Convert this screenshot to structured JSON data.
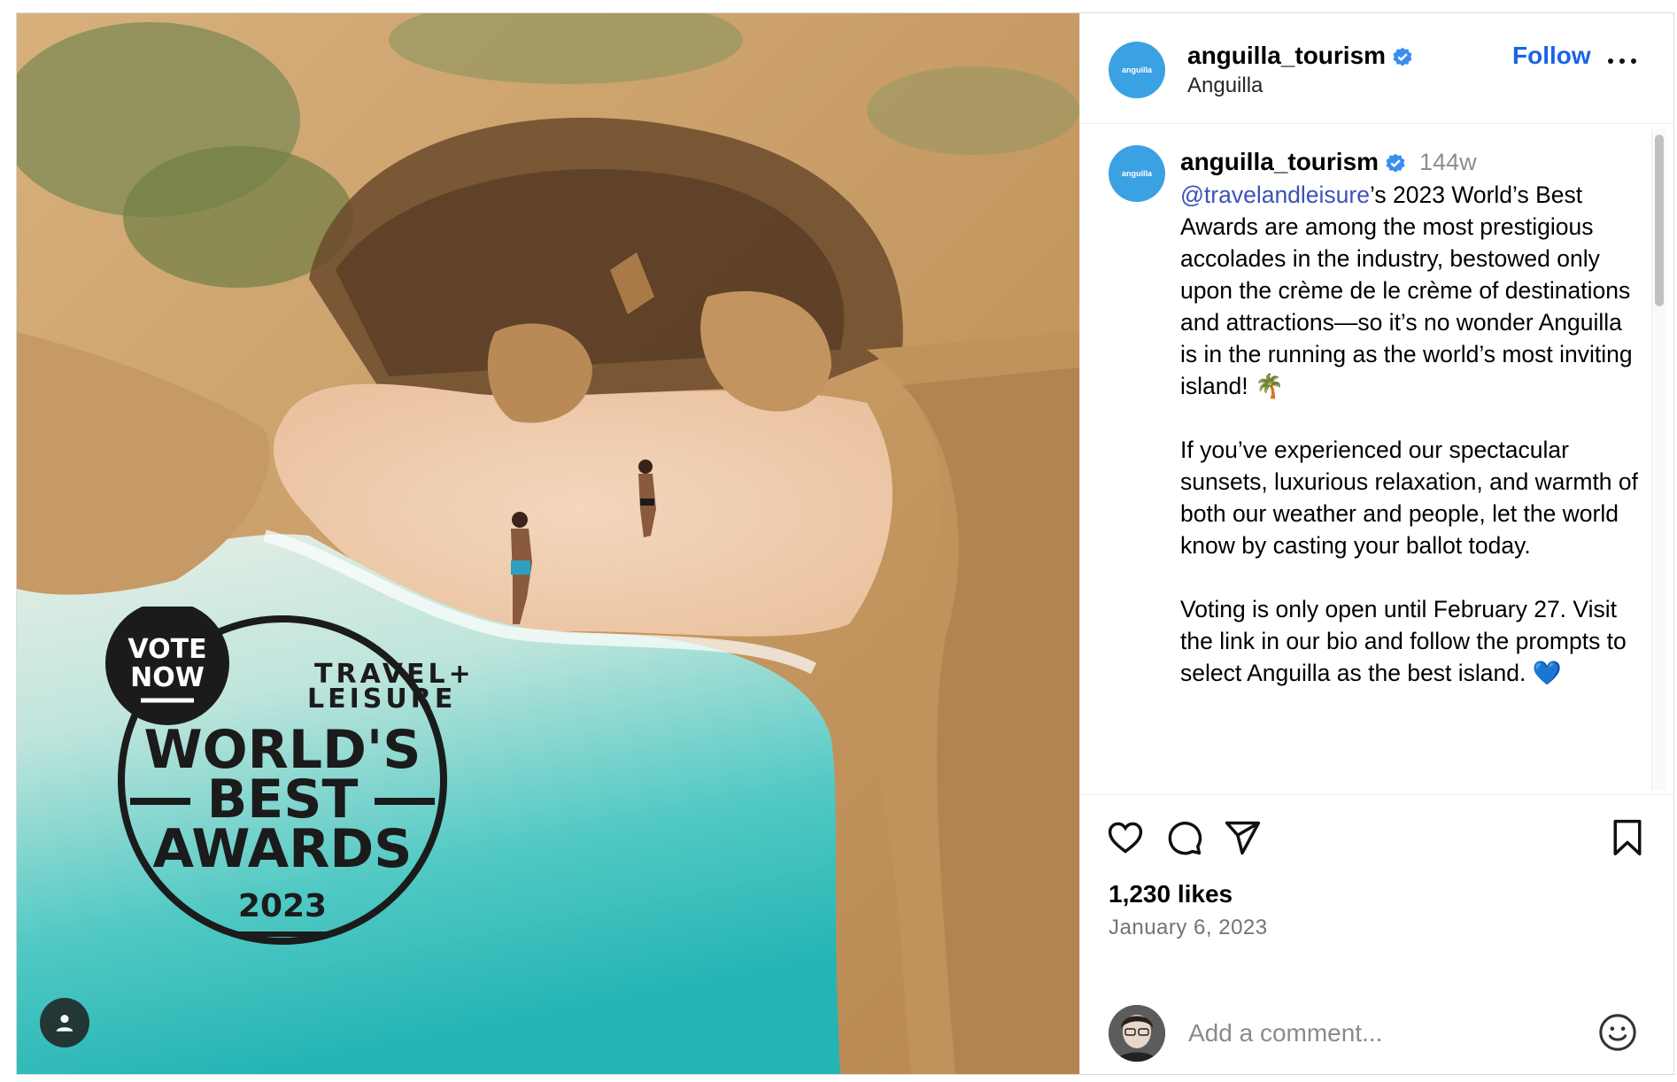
{
  "badge": {
    "vote_line1": "VOTE",
    "vote_line2": "NOW",
    "brand_line1": "TRAVEL+",
    "brand_line2": "LEISURE",
    "award_line1": "WORLD'S",
    "award_line2": "BEST",
    "award_line3": "AWARDS",
    "year": "2023"
  },
  "account": {
    "username": "anguilla_tourism",
    "avatar_text": "anguilla",
    "location": "Anguilla",
    "follow_label": "Follow",
    "verified": true
  },
  "caption": {
    "username": "anguilla_tourism",
    "time": "144w",
    "mention": "@travelandleisure",
    "text": "’s 2023 World’s Best Awards are among the most prestigious accolades in the industry, bestowed only upon the crème de le crème of destinations and attractions—so it’s no wonder Anguilla is in the running as the world’s most inviting island! 🌴\n\nIf you’ve experienced our spectacular sunsets, luxurious relaxation, and warmth of both our weather and people, let the world know by casting your ballot today.\n\nVoting is only open until February 27. Visit the link in our bio and follow the prompts to select Anguilla as the best island. 💙"
  },
  "stats": {
    "likes": "1,230 likes",
    "date": "January 6, 2023"
  },
  "comment_box": {
    "placeholder": "Add a comment..."
  },
  "icons": [
    "heart-icon",
    "comment-icon",
    "share-icon",
    "bookmark-icon",
    "emoji-icon",
    "more-options-icon",
    "verified-icon",
    "user-tag-icon"
  ],
  "colors": {
    "link": "#1b63e6",
    "mention": "#3d52b8",
    "verified": "#3b8df0",
    "avatar": "#3aa2e3"
  }
}
